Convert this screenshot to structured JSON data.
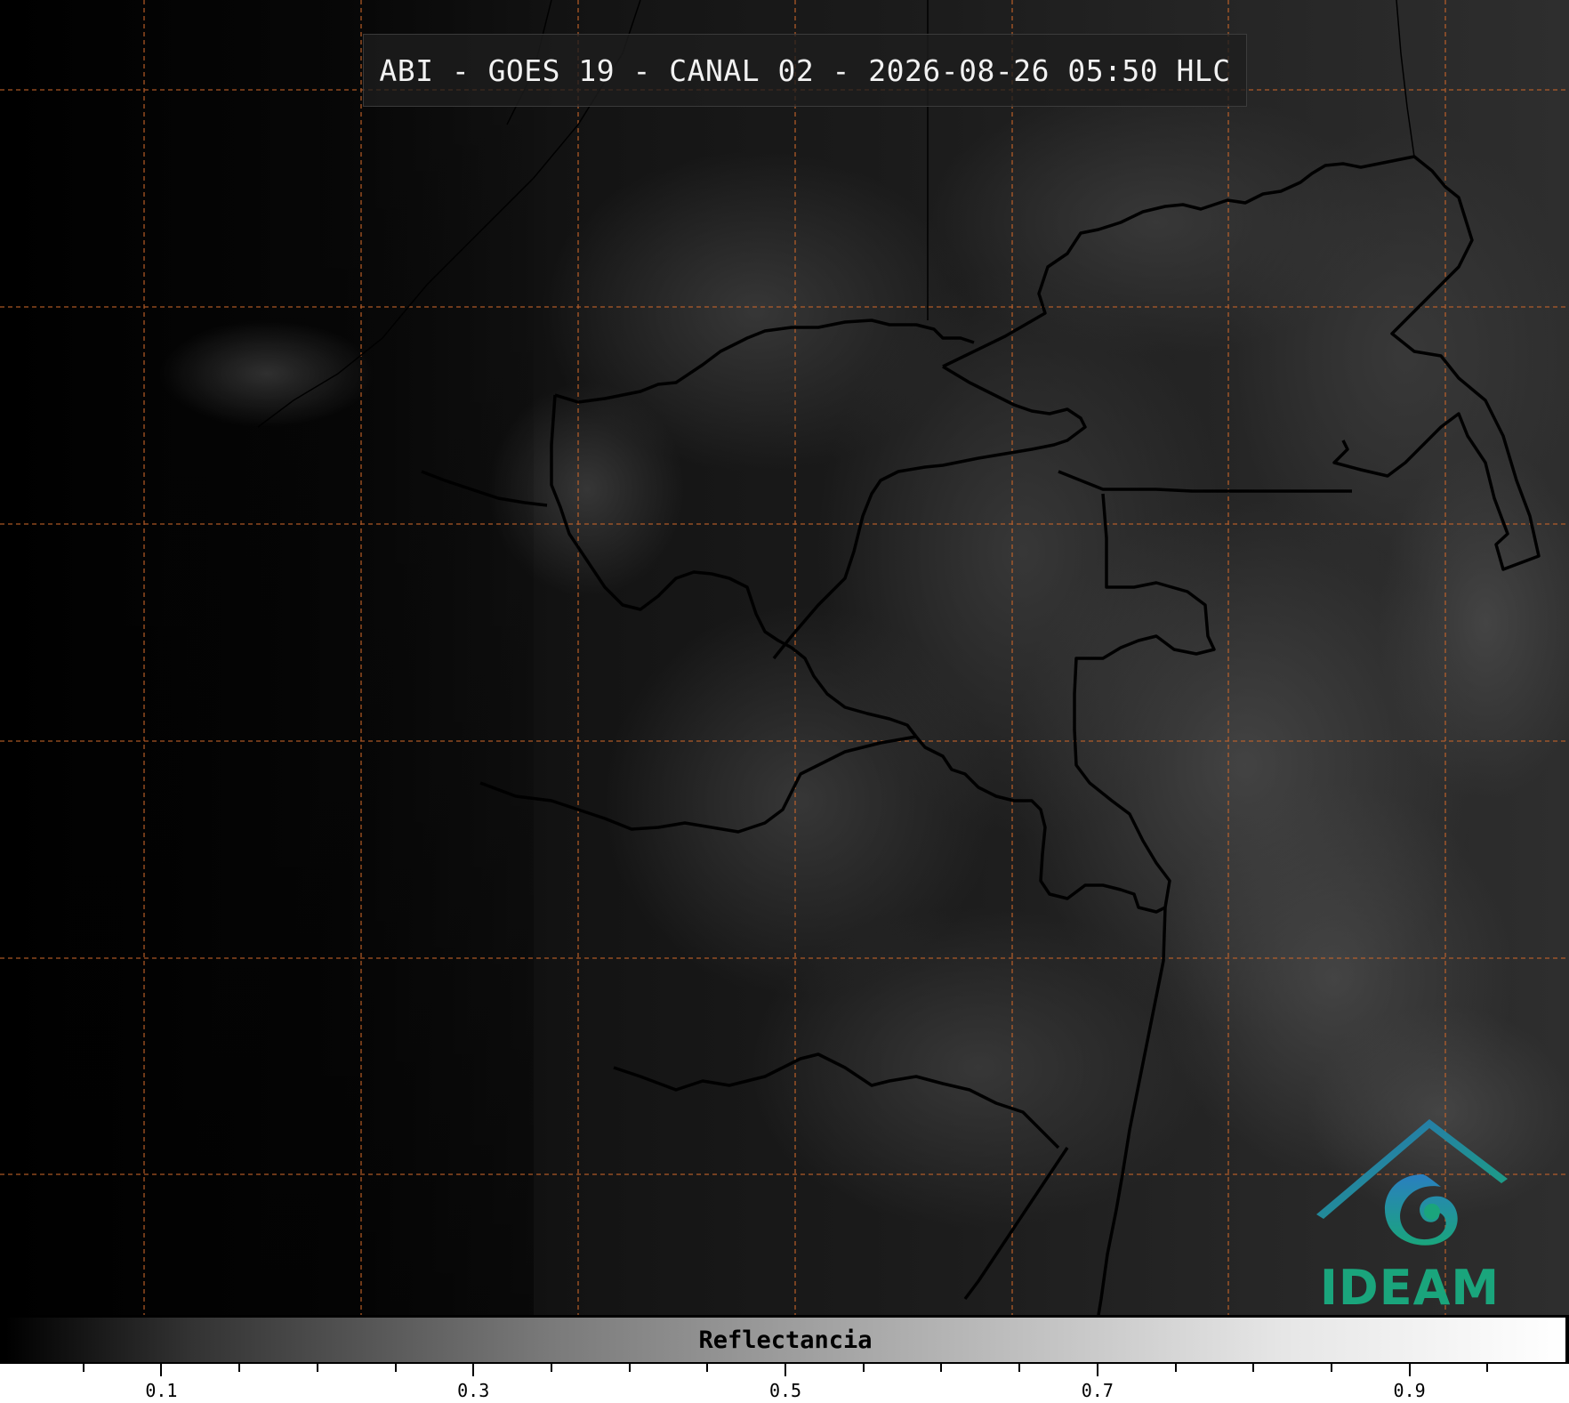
{
  "title": "ABI - GOES 19 - CANAL 02 - 2026-08-26 05:50 HLC",
  "logo": {
    "text": "IDEAM",
    "icon": "ideam-logo-icon",
    "color": "#1aa57c",
    "roof_color": "#2a6fb8"
  },
  "colorbar": {
    "label": "Reflectancia",
    "min": 0.0,
    "max": 1.0,
    "major_ticks": [
      {
        "value": 0.1,
        "label": "0.1"
      },
      {
        "value": 0.3,
        "label": "0.3"
      },
      {
        "value": 0.5,
        "label": "0.5"
      },
      {
        "value": 0.7,
        "label": "0.7"
      },
      {
        "value": 0.9,
        "label": "0.9"
      }
    ],
    "minor_ticks": [
      0.05,
      0.15,
      0.2,
      0.25,
      0.35,
      0.4,
      0.45,
      0.55,
      0.6,
      0.65,
      0.75,
      0.8,
      0.85,
      0.95
    ]
  },
  "gridlines": {
    "color": "#c8652a",
    "style": "dashed"
  },
  "borders": {
    "color": "#000000"
  }
}
